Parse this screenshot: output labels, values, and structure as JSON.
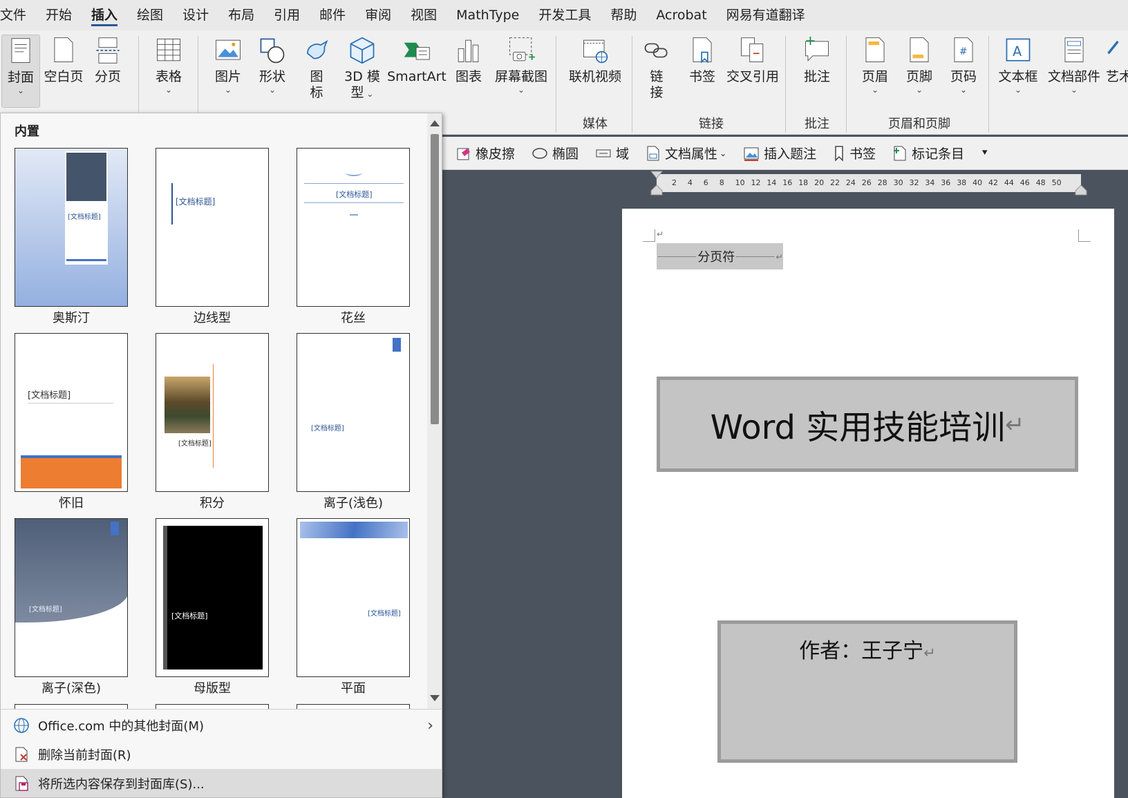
{
  "menu": {
    "tabs": [
      "文件",
      "开始",
      "插入",
      "绘图",
      "设计",
      "布局",
      "引用",
      "邮件",
      "审阅",
      "视图",
      "MathType",
      "开发工具",
      "帮助",
      "Acrobat",
      "网易有道翻译"
    ],
    "active_tab": "插入"
  },
  "ribbon": {
    "cover": "封面",
    "blank_page": "空白页",
    "page_break": "分页",
    "table": "表格",
    "picture": "图片",
    "shapes": "形状",
    "icons_line1": "图",
    "icons_line2": "标",
    "model3d_line1": "3D 模",
    "model3d_line2": "型",
    "smartart": "SmartArt",
    "chart": "图表",
    "screenshot": "屏幕截图",
    "online_video": "联机视频",
    "link_line1": "链",
    "link_line2": "接",
    "bookmark": "书签",
    "cross_ref": "交叉引用",
    "comment": "批注",
    "header": "页眉",
    "footer": "页脚",
    "page_number": "页码",
    "textbox": "文本框",
    "doc_parts": "文档部件",
    "wordart": "艺术",
    "group_media": "媒体",
    "group_links": "链接",
    "group_comments": "批注",
    "group_header_footer": "页眉和页脚"
  },
  "toolbar2": {
    "eraser": "橡皮擦",
    "ellipse": "椭圆",
    "field": "域",
    "doc_props": "文档属性",
    "insert_caption": "插入题注",
    "bookmark": "书签",
    "mark_entry": "标记条目",
    "more": "⯆"
  },
  "ruler": {
    "numbers": [
      "2",
      "4",
      "6",
      "8",
      "10",
      "12",
      "14",
      "16",
      "18",
      "20",
      "22",
      "24",
      "26",
      "28",
      "30",
      "32",
      "34",
      "36",
      "38",
      "40",
      "42",
      "44",
      "46",
      "48",
      "50"
    ]
  },
  "document": {
    "page_break_label": "分页符",
    "title": "Word 实用技能培训",
    "author": "作者：王子宁",
    "pilcrow": "↵"
  },
  "gallery": {
    "heading": "内置",
    "covers": [
      {
        "name": "奥斯汀",
        "placeholder": "[文档标题]"
      },
      {
        "name": "边线型",
        "placeholder": "[文档标题]"
      },
      {
        "name": "花丝",
        "placeholder": "[文档标题]"
      },
      {
        "name": "怀旧",
        "placeholder": "[文档标题]"
      },
      {
        "name": "积分",
        "placeholder": "[文档标题]"
      },
      {
        "name": "离子(浅色)",
        "placeholder": "[文档标题]"
      },
      {
        "name": "离子(深色)",
        "placeholder": "[文档标题]"
      },
      {
        "name": "母版型",
        "placeholder": "[文档标题]"
      },
      {
        "name": "平面",
        "placeholder": "[文档标题]"
      }
    ],
    "footer_items": [
      {
        "label": "Office.com 中的其他封面(M)",
        "submenu": "›"
      },
      {
        "label": "删除当前封面(R)"
      },
      {
        "label": "将所选内容保存到封面库(S)..."
      }
    ]
  },
  "colors": {
    "accent_blue": "#2b579a",
    "doc_background": "#4b535e",
    "ribbon_bg": "#f0f0f0",
    "textbox_fill": "#c4c4c4",
    "cover_orange": "#ed7d31"
  }
}
